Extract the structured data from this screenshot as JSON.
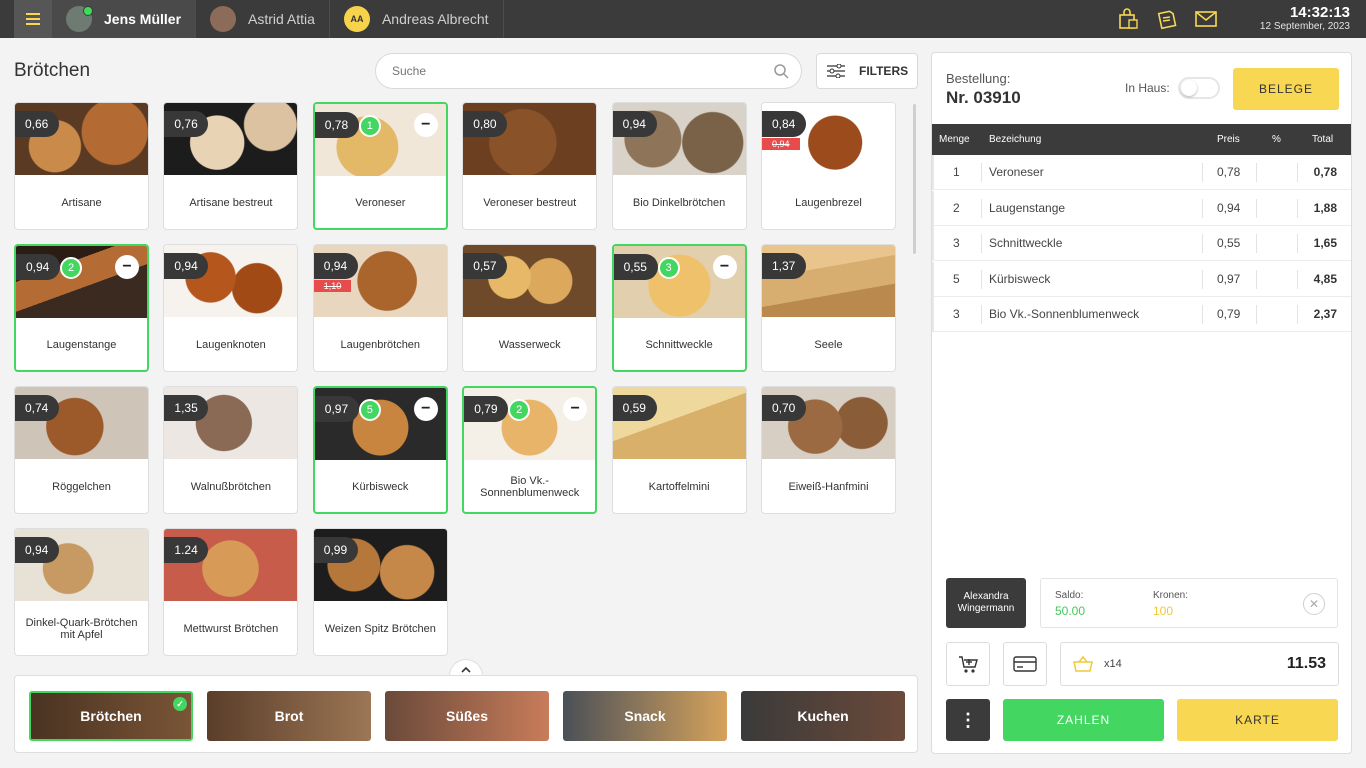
{
  "topbar": {
    "users": [
      {
        "name": "Jens Müller"
      },
      {
        "name": "Astrid Attia"
      },
      {
        "name": "Andreas Albrecht",
        "initials": "AA"
      }
    ],
    "time": "14:32:13",
    "date": "12 September, 2023",
    "icons": [
      "menu-icon",
      "shopping-bag-icon",
      "receipt-icon",
      "mail-icon"
    ]
  },
  "catalog": {
    "title": "Brötchen",
    "search_placeholder": "Suche",
    "filters_label": "FILTERS"
  },
  "products": [
    {
      "name": "Artisane",
      "price": "0,66"
    },
    {
      "name": "Artisane bestreut",
      "price": "0,76"
    },
    {
      "name": "Veroneser",
      "price": "0,78",
      "qty": "1",
      "selected": true
    },
    {
      "name": "Veroneser bestreut",
      "price": "0,80"
    },
    {
      "name": "Bio Dinkelbrötchen",
      "price": "0,94"
    },
    {
      "name": "Laugenbrezel",
      "price": "0,84",
      "old_price": "0,94"
    },
    {
      "name": "Laugenstange",
      "price": "0,94",
      "qty": "2",
      "selected": true
    },
    {
      "name": "Laugenknoten",
      "price": "0,94"
    },
    {
      "name": "Laugenbrötchen",
      "price": "0,94",
      "old_price": "1,10"
    },
    {
      "name": "Wasserweck",
      "price": "0,57"
    },
    {
      "name": "Schnittweckle",
      "price": "0,55",
      "qty": "3",
      "selected": true
    },
    {
      "name": "Seele",
      "price": "1,37"
    },
    {
      "name": "Röggelchen",
      "price": "0,74"
    },
    {
      "name": "Walnußbrötchen",
      "price": "1,35"
    },
    {
      "name": "Kürbisweck",
      "price": "0,97",
      "qty": "5",
      "selected": true
    },
    {
      "name": "Bio Vk.-Sonnenblumenweck",
      "price": "0,79",
      "qty": "2",
      "selected": true
    },
    {
      "name": "Kartoffelmini",
      "price": "0,59"
    },
    {
      "name": "Eiweiß-Hanfmini",
      "price": "0,70"
    },
    {
      "name": "Dinkel-Quark-Brötchen mit Apfel",
      "price": "0,94"
    },
    {
      "name": "Mettwurst Brötchen",
      "price": "1.24"
    },
    {
      "name": "Weizen Spitz Brötchen",
      "price": "0,99"
    }
  ],
  "categories": [
    {
      "label": "Brötchen",
      "active": true
    },
    {
      "label": "Brot"
    },
    {
      "label": "Süßes"
    },
    {
      "label": "Snack"
    },
    {
      "label": "Kuchen"
    }
  ],
  "order": {
    "label": "Bestellung:",
    "number": "Nr. 03910",
    "inhaus_label": "In Haus:",
    "inhaus_on": false,
    "belege_label": "BELEGE",
    "columns": {
      "menge": "Menge",
      "bezeichung": "Bezeichung",
      "preis": "Preis",
      "pct": "%",
      "total": "Total"
    },
    "rows": [
      {
        "menge": "1",
        "name": "Veroneser",
        "preis": "0,78",
        "pct": "",
        "total": "0,78"
      },
      {
        "menge": "2",
        "name": "Laugenstange",
        "preis": "0,94",
        "pct": "",
        "total": "1,88"
      },
      {
        "menge": "3",
        "name": "Schnittweckle",
        "preis": "0,55",
        "pct": "",
        "total": "1,65"
      },
      {
        "menge": "5",
        "name": "Kürbisweck",
        "preis": "0,97",
        "pct": "",
        "total": "4,85"
      },
      {
        "menge": "3",
        "name": "Bio Vk.-Sonnenblumenweck",
        "preis": "0,79",
        "pct": "",
        "total": "2,37"
      }
    ],
    "customer": "Alexandra Wingermann",
    "saldo_label": "Saldo:",
    "saldo_value": "50.00",
    "kronen_label": "Kronen:",
    "kronen_value": "100",
    "item_count": "x14",
    "total": "11.53",
    "zahlen_label": "ZAHLEN",
    "karte_label": "KARTE",
    "colors": {
      "accent_green": "#43d661",
      "accent_yellow": "#f8d752",
      "dark": "#3b3b3b"
    }
  }
}
